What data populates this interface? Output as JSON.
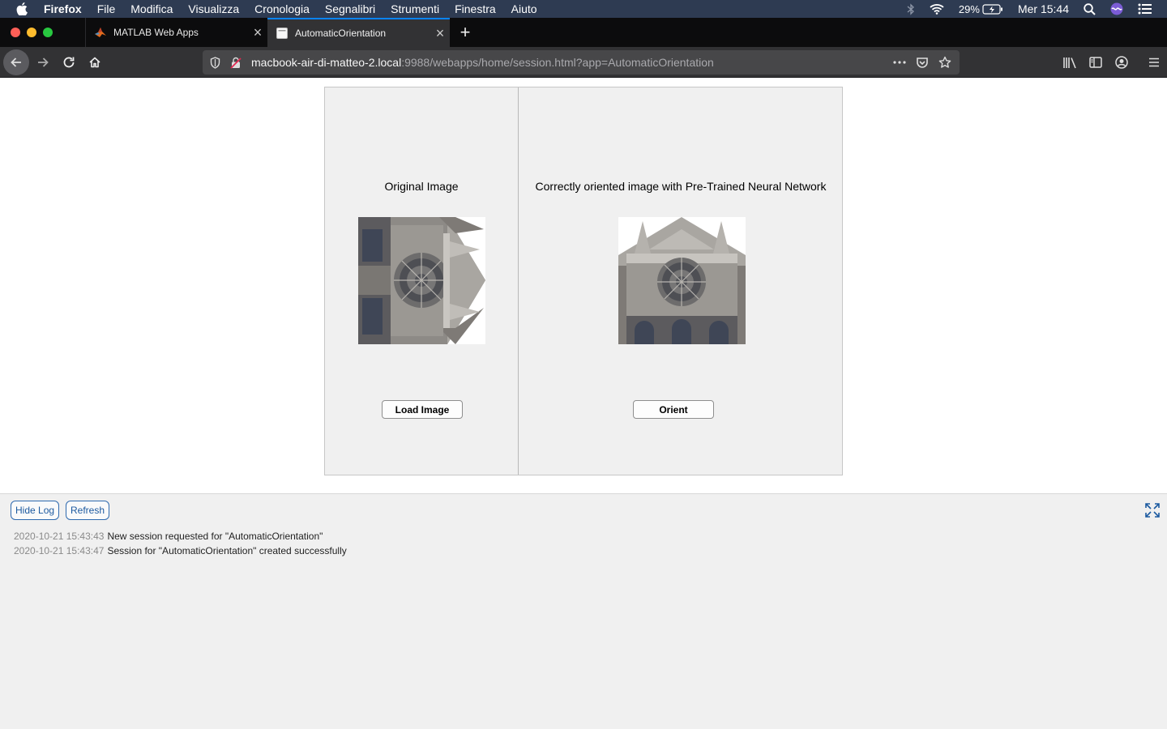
{
  "menubar": {
    "items": [
      "Firefox",
      "File",
      "Modifica",
      "Visualizza",
      "Cronologia",
      "Segnalibri",
      "Strumenti",
      "Finestra",
      "Aiuto"
    ],
    "battery": "29%",
    "clock": "Mer 15:44"
  },
  "tabs": [
    {
      "title": "MATLAB Web Apps",
      "favicon": "matlab-icon"
    },
    {
      "title": "AutomaticOrientation",
      "favicon": "page-icon",
      "active": true
    }
  ],
  "url": {
    "host": "macbook-air-di-matteo-2.local",
    "path": ":9988/webapps/home/session.html?app=AutomaticOrientation"
  },
  "app": {
    "left_title": "Original Image",
    "right_title": "Correctly oriented image with Pre-Trained Neural Network",
    "load_button": "Load Image",
    "orient_button": "Orient"
  },
  "log": {
    "hide_button": "Hide Log",
    "refresh_button": "Refresh",
    "entries": [
      {
        "time": "2020-10-21 15:43:43",
        "message": "New session requested for \"AutomaticOrientation\""
      },
      {
        "time": "2020-10-21 15:43:47",
        "message": "Session for \"AutomaticOrientation\" created successfully"
      }
    ]
  },
  "colors": {
    "menubar": "#2e3b52",
    "tabbar": "#0c0c0d",
    "accent": "#0a84ff",
    "app_bg": "#f0f0f0",
    "log_button": "#2f6aaf"
  }
}
